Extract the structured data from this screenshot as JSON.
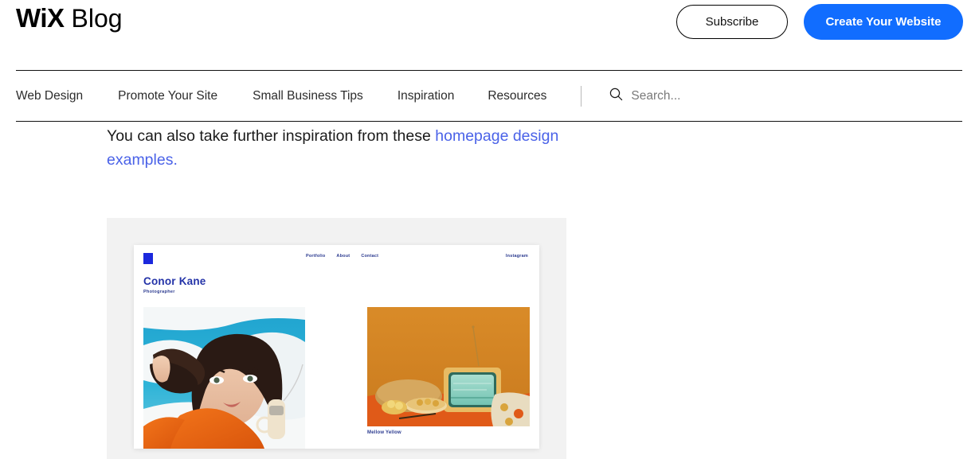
{
  "header": {
    "logo_wix": "WiX",
    "logo_blog": "Blog",
    "subscribe_label": "Subscribe",
    "create_label": "Create Your Website",
    "accent_blue": "#116dff"
  },
  "nav": {
    "items": [
      {
        "label": "Web Design"
      },
      {
        "label": "Promote Your Site"
      },
      {
        "label": "Small Business Tips"
      },
      {
        "label": "Inspiration"
      },
      {
        "label": "Resources"
      }
    ],
    "search_placeholder": "Search...",
    "search_icon": "search-icon"
  },
  "article": {
    "paragraph_lead": "You can also take further inspiration from these ",
    "paragraph_link": "homepage design examples.",
    "link_color": "#4a62e8"
  },
  "figure": {
    "site": {
      "logo_icon": "blue-square-logo",
      "nav": [
        {
          "label": "Portfolio"
        },
        {
          "label": "About"
        },
        {
          "label": "Contact"
        }
      ],
      "social_label": "Instagram",
      "title": "Conor Kane",
      "subtitle": "Photographer",
      "title_color": "#2433a8",
      "photo_left_alt": "Woman in orange top holding vintage telephone against blue sky",
      "photo_right_alt": "Retro television with mint green screen on orange backdrop",
      "photo_right_caption": "Mellow Yellow"
    }
  }
}
